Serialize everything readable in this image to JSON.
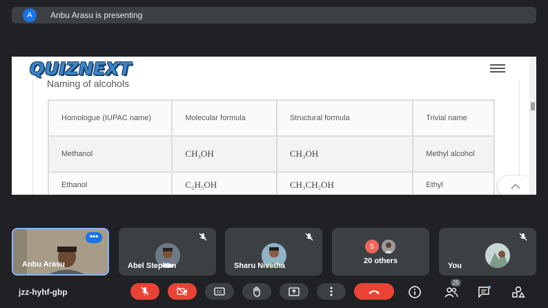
{
  "banner": {
    "avatar_letter": "A",
    "text": "Anbu Arasu is presenting"
  },
  "shared": {
    "logo": "QUIZNEXT",
    "heading": "Naming of alcohols",
    "table": {
      "headers": [
        "Homologue (IUPAC name)",
        "Molecular formula",
        "Structural formula",
        "Trivial name"
      ],
      "rows": [
        {
          "homologue": "Methanol",
          "molecular": "CH₃OH",
          "structural": "CH₃OH",
          "trivial": "Methyl alcohol"
        },
        {
          "homologue": "Ethanol",
          "molecular": "C₂H₅OH",
          "structural": "CH₃CH₂OH",
          "trivial": "Ethyl"
        }
      ]
    }
  },
  "tiles": [
    {
      "name": "Anbu Arasu",
      "menu": "•••"
    },
    {
      "name": "Abel Stephen"
    },
    {
      "name": "Sharu Nivetha"
    },
    {
      "name": "20 others",
      "letter": "S"
    },
    {
      "name": "You"
    }
  ],
  "meeting": {
    "code": "jzz-hyhf-gbp",
    "participants_count": "25"
  },
  "colors": {
    "end_call": "#ea4335",
    "accent": "#1a73e8",
    "background": "#202124",
    "tile": "#3c4043"
  }
}
